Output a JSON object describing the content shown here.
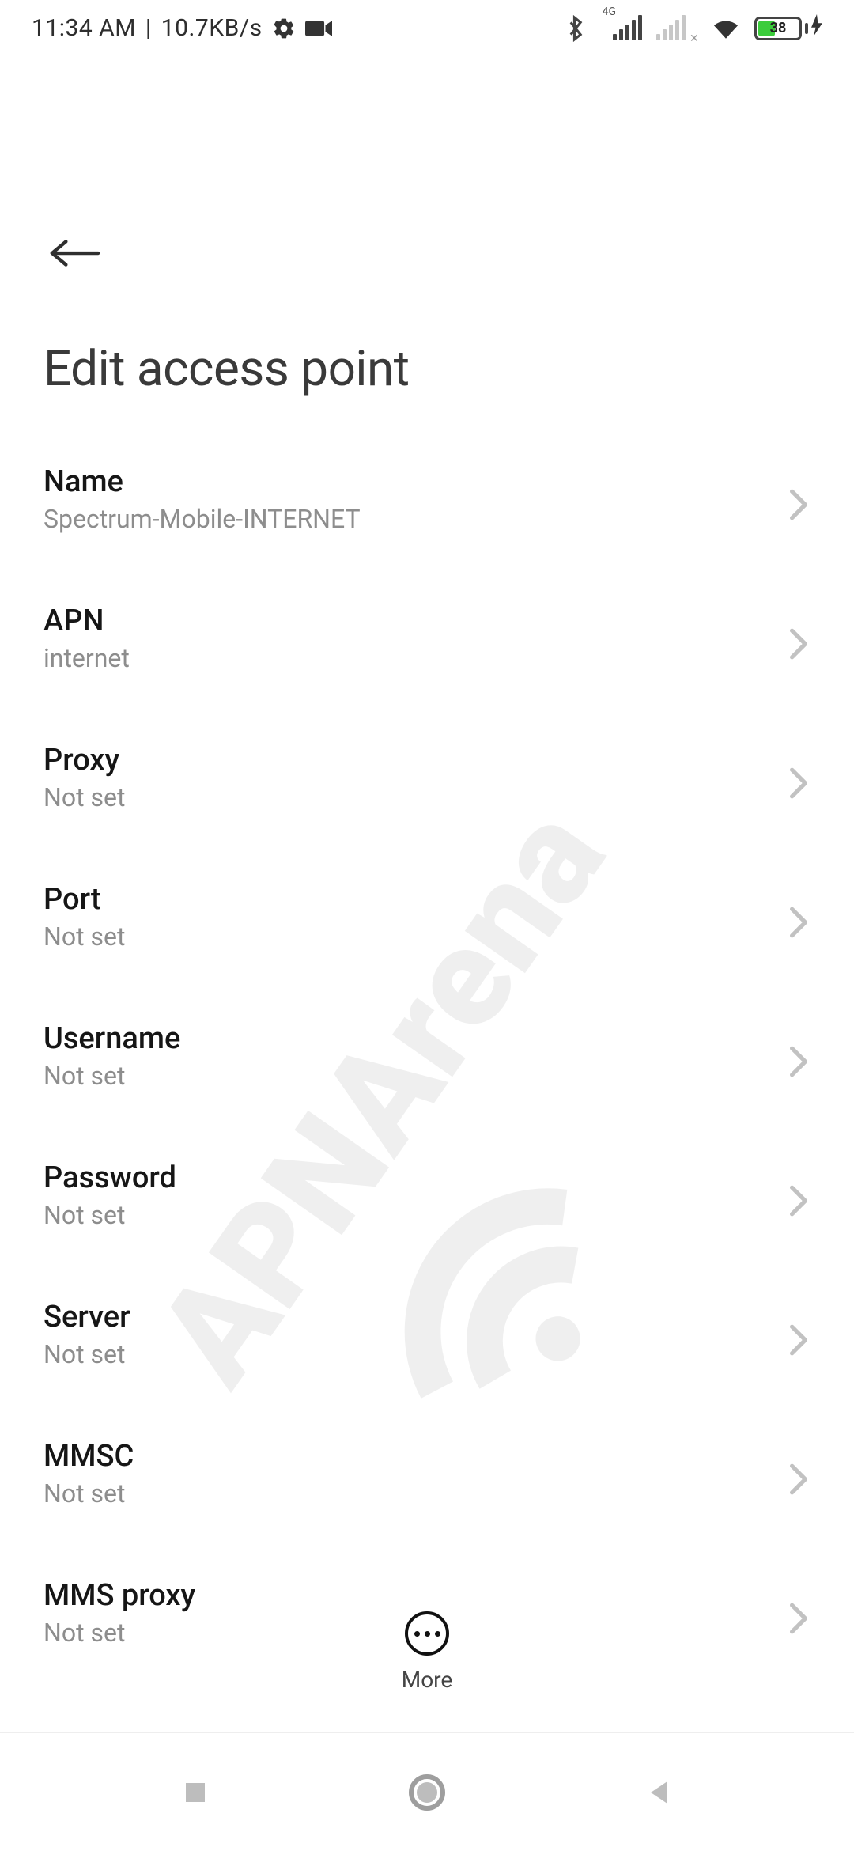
{
  "status": {
    "time": "11:34 AM",
    "sep": "|",
    "speed": "10.7KB/s",
    "network_label": "4G",
    "battery_pct": "38"
  },
  "header": {
    "title": "Edit access point"
  },
  "rows": [
    {
      "label": "Name",
      "value": "Spectrum-Mobile-INTERNET"
    },
    {
      "label": "APN",
      "value": "internet"
    },
    {
      "label": "Proxy",
      "value": "Not set"
    },
    {
      "label": "Port",
      "value": "Not set"
    },
    {
      "label": "Username",
      "value": "Not set"
    },
    {
      "label": "Password",
      "value": "Not set"
    },
    {
      "label": "Server",
      "value": "Not set"
    },
    {
      "label": "MMSC",
      "value": "Not set"
    },
    {
      "label": "MMS proxy",
      "value": "Not set"
    }
  ],
  "fab": {
    "label": "More"
  },
  "watermark": "APNArena"
}
